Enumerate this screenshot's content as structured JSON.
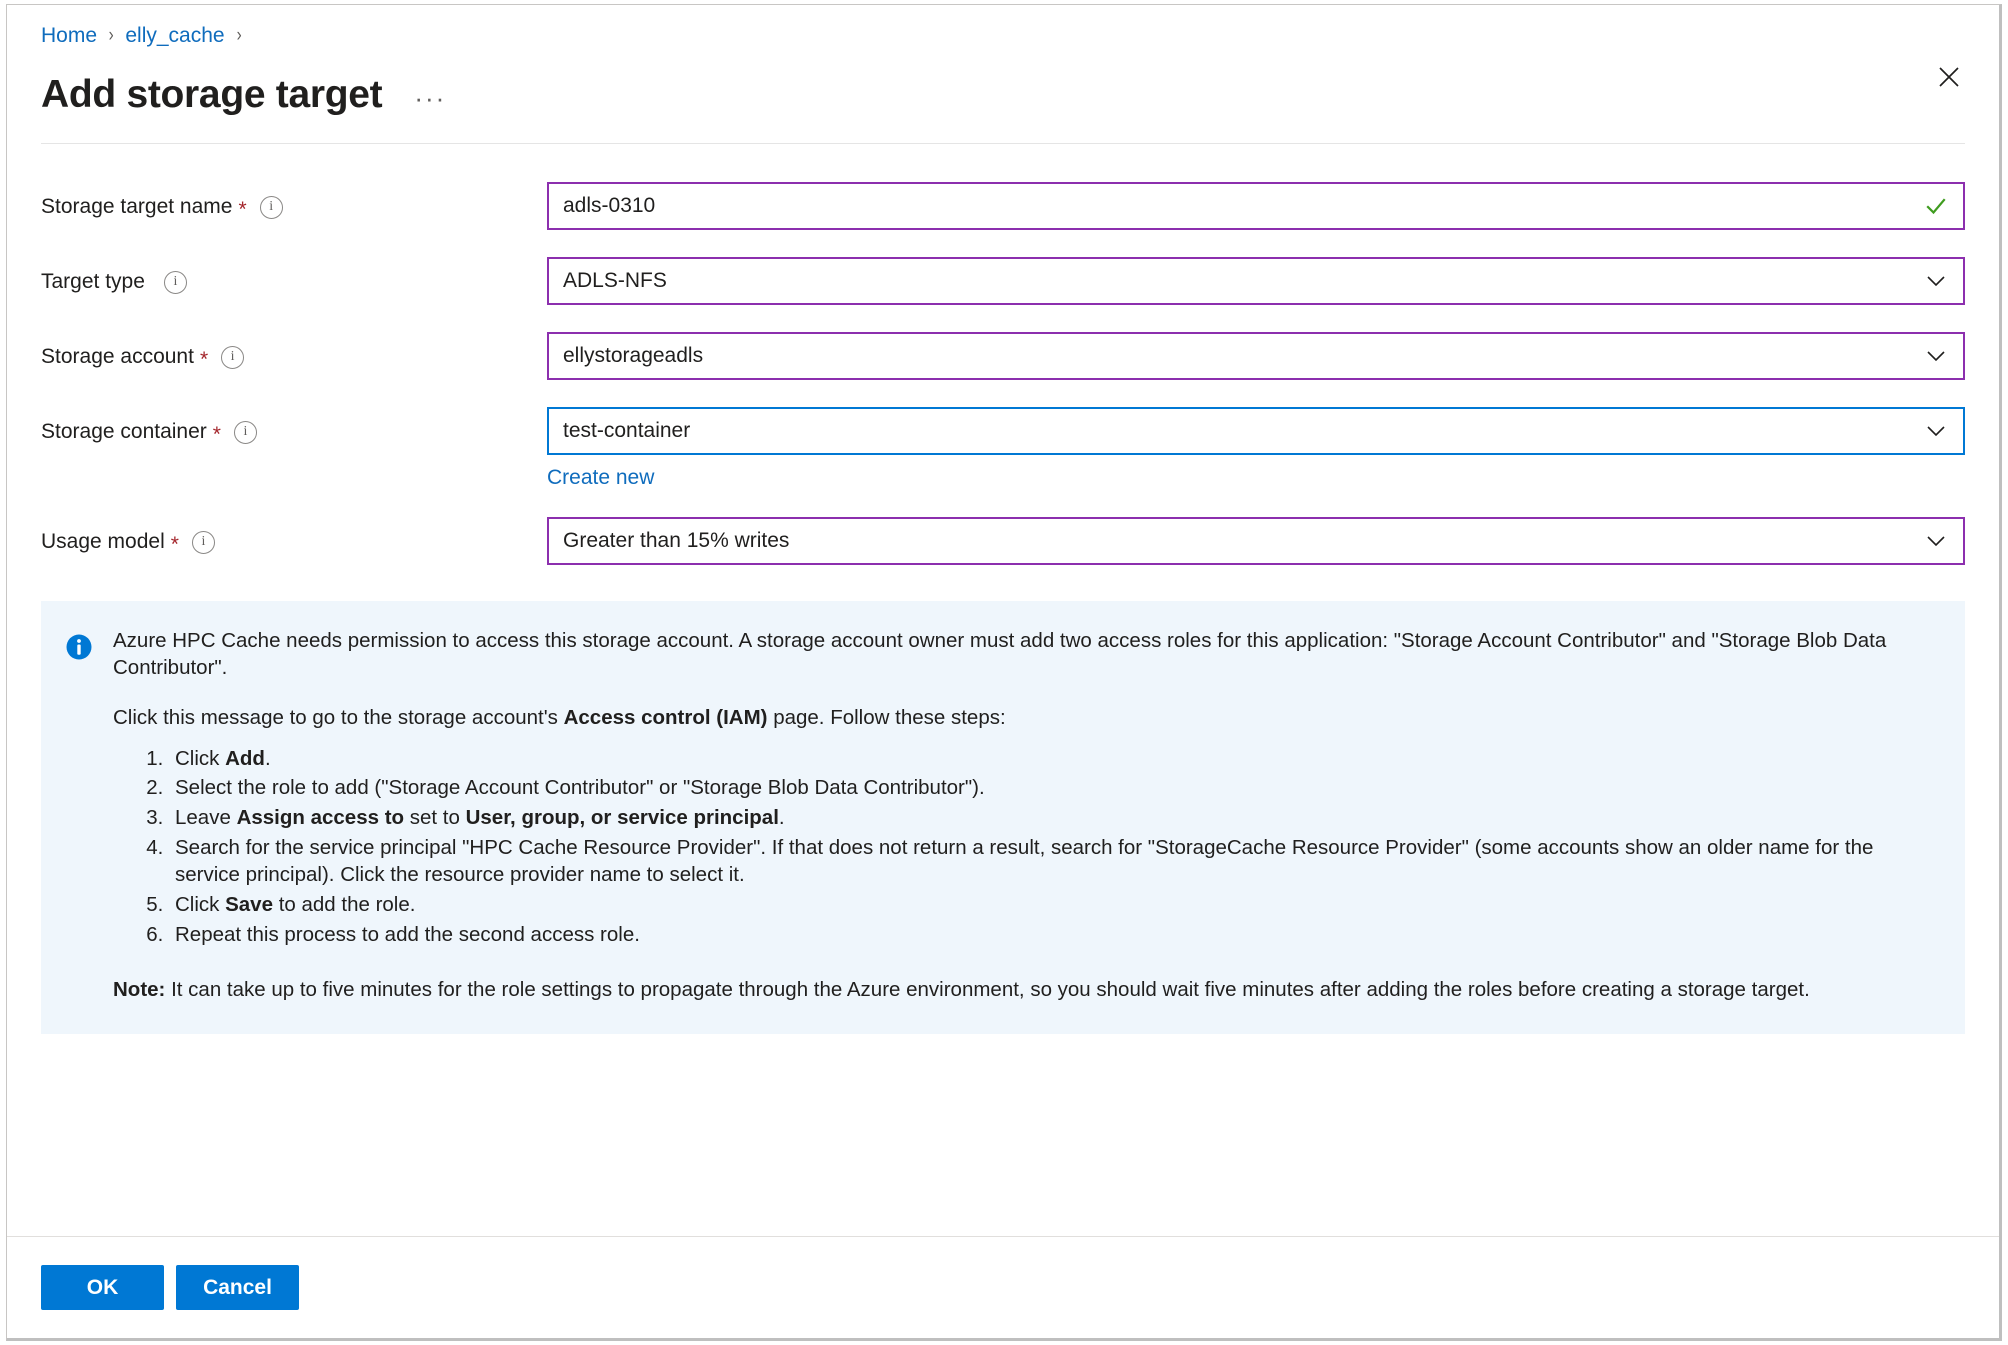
{
  "breadcrumb": {
    "items": [
      {
        "label": "Home"
      },
      {
        "label": "elly_cache"
      }
    ],
    "separator": "›"
  },
  "header": {
    "title": "Add storage target",
    "more_label": "···",
    "close_label": "Close"
  },
  "form": {
    "fields": [
      {
        "label": "Storage target name",
        "required_marker": "*",
        "value": "adls-0310",
        "state": "valid-text"
      },
      {
        "label": "Target type",
        "required_marker": "",
        "value": "ADLS-NFS",
        "state": "dropdown"
      },
      {
        "label": "Storage account",
        "required_marker": "*",
        "value": "ellystorageadls",
        "state": "dropdown"
      },
      {
        "label": "Storage container",
        "required_marker": "*",
        "value": "test-container",
        "state": "dropdown-focused",
        "sublink": "Create new"
      },
      {
        "label": "Usage model",
        "required_marker": "*",
        "value": "Greater than 15% writes",
        "state": "dropdown"
      }
    ]
  },
  "banner": {
    "icon": "info-icon",
    "paragraph1": "Azure HPC Cache needs permission to access this storage account. A storage account owner must add two access roles for this application: \"Storage Account Contributor\" and \"Storage Blob Data Contributor\".",
    "paragraph2_before": "Click this message to go to the storage account's ",
    "paragraph2_bold": "Access control (IAM)",
    "paragraph2_after": " page. Follow these steps:",
    "steps": [
      {
        "before": "Click ",
        "bold": "Add",
        "after": "."
      },
      {
        "before": " Select the role to add (\"Storage Account Contributor\" or \"Storage Blob Data Contributor\").",
        "bold": "",
        "after": ""
      },
      {
        "before": "Leave ",
        "bold": "Assign access to",
        "after": " set to ",
        "bold2": "User, group, or service principal",
        "after2": "."
      },
      {
        "before": "Search for the service principal \"HPC Cache Resource Provider\". If that does not return a result, search for \"StorageCache Resource Provider\" (some accounts show an older name for the service principal). Click the resource provider name to select it.",
        "bold": "",
        "after": ""
      },
      {
        "before": "Click ",
        "bold": "Save",
        "after": " to add the role."
      },
      {
        "before": "Repeat this process to add the second access role.",
        "bold": "",
        "after": ""
      }
    ],
    "note_label": "Note:",
    "note_text": " It can take up to five minutes for the role settings to propagate through the Azure environment, so you should wait five minutes after adding the roles before creating a storage target."
  },
  "footer": {
    "ok_label": "OK",
    "cancel_label": "Cancel"
  },
  "colors": {
    "accent_blue": "#0078d4",
    "link_blue": "#0f6cbd",
    "field_purple": "#8c2fae",
    "required_red": "#a4262c",
    "valid_green": "#3f9c1f",
    "banner_bg": "#eff6fc"
  }
}
